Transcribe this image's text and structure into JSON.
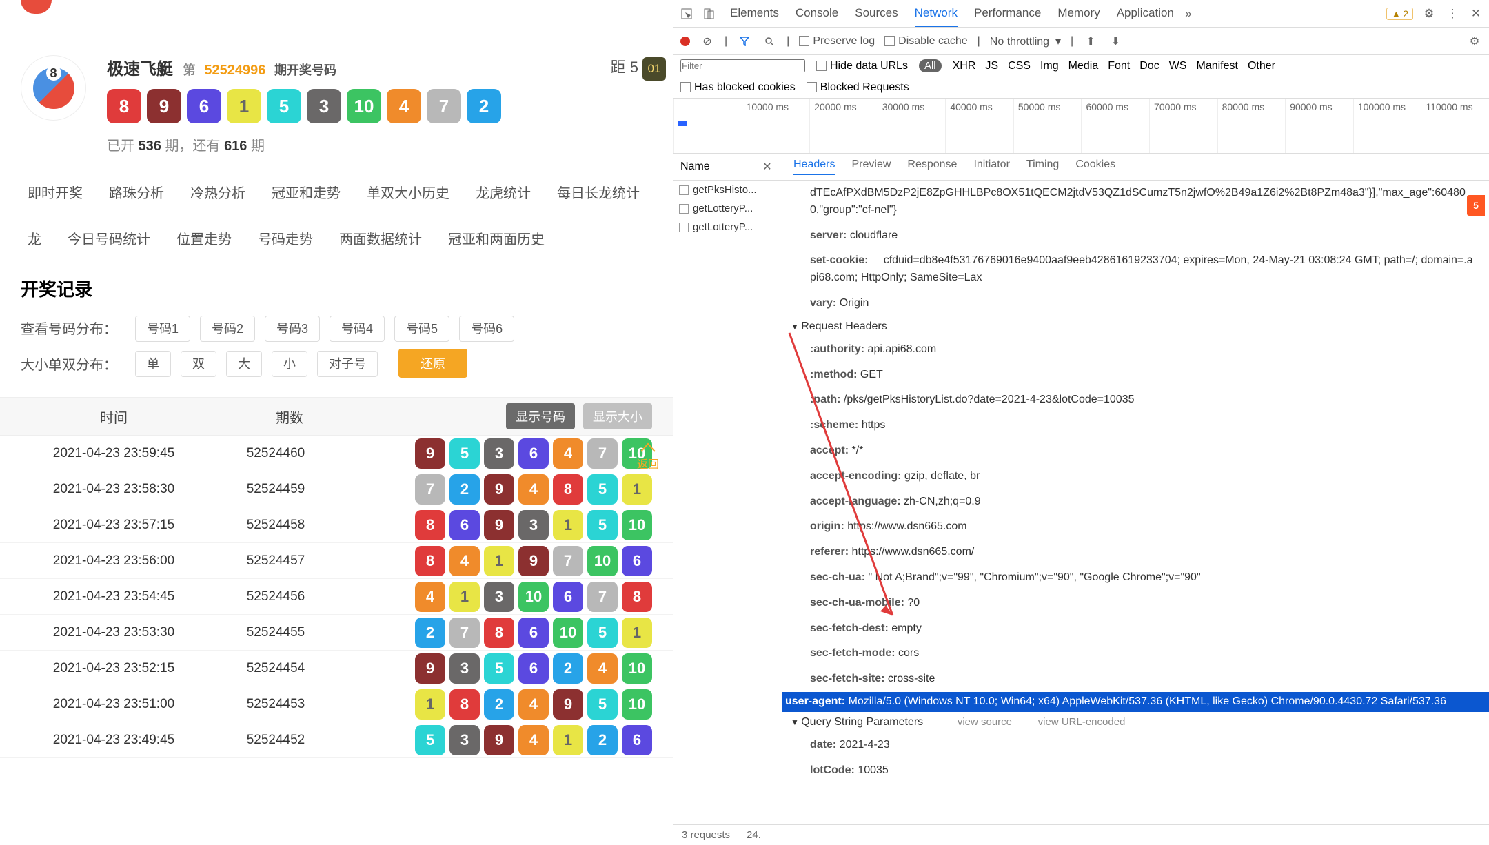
{
  "page": {
    "title": "极速飞艇",
    "di": "第",
    "issue": "52524996",
    "issue_label": "期开奖号码",
    "balls": [
      8,
      9,
      6,
      1,
      5,
      3,
      10,
      4,
      7,
      2
    ],
    "stat_prefix": "已开",
    "stat_open": "536",
    "stat_mid": "期，还有",
    "stat_left": "616",
    "stat_suffix": "期",
    "side_prefix": "距 5",
    "side_num": "01"
  },
  "tabs": [
    "即时开奖",
    "路珠分析",
    "冷热分析",
    "冠亚和走势",
    "单双大小历史",
    "龙虎统计",
    "每日长龙统计",
    "龙",
    "今日号码统计",
    "位置走势",
    "号码走势",
    "两面数据统计",
    "冠亚和两面历史"
  ],
  "section": "开奖记录",
  "filter1": {
    "label": "查看号码分布：",
    "opts": [
      "号码1",
      "号码2",
      "号码3",
      "号码4",
      "号码5",
      "号码6"
    ]
  },
  "filter2": {
    "label": "大小单双分布：",
    "opts": [
      "单",
      "双",
      "大",
      "小",
      "对子号"
    ],
    "reset": "还原"
  },
  "back": "返回",
  "thead": {
    "time": "时间",
    "issue": "期数",
    "btn1": "显示号码",
    "btn2": "显示大小"
  },
  "rows": [
    {
      "t": "2021-04-23 23:59:45",
      "i": "52524460",
      "n": [
        9,
        5,
        3,
        6,
        4,
        7,
        10
      ]
    },
    {
      "t": "2021-04-23 23:58:30",
      "i": "52524459",
      "n": [
        7,
        2,
        9,
        4,
        8,
        5,
        1
      ]
    },
    {
      "t": "2021-04-23 23:57:15",
      "i": "52524458",
      "n": [
        8,
        6,
        9,
        3,
        1,
        5,
        10
      ]
    },
    {
      "t": "2021-04-23 23:56:00",
      "i": "52524457",
      "n": [
        8,
        4,
        1,
        9,
        7,
        10,
        6
      ]
    },
    {
      "t": "2021-04-23 23:54:45",
      "i": "52524456",
      "n": [
        4,
        1,
        3,
        10,
        6,
        7,
        8
      ]
    },
    {
      "t": "2021-04-23 23:53:30",
      "i": "52524455",
      "n": [
        2,
        7,
        8,
        6,
        10,
        5,
        1
      ]
    },
    {
      "t": "2021-04-23 23:52:15",
      "i": "52524454",
      "n": [
        9,
        3,
        5,
        6,
        2,
        4,
        10
      ]
    },
    {
      "t": "2021-04-23 23:51:00",
      "i": "52524453",
      "n": [
        1,
        8,
        2,
        4,
        9,
        5,
        10
      ]
    },
    {
      "t": "2021-04-23 23:49:45",
      "i": "52524452",
      "n": [
        5,
        3,
        9,
        4,
        1,
        2,
        6
      ]
    }
  ],
  "dt": {
    "tabs": [
      "Elements",
      "Console",
      "Sources",
      "Network",
      "Performance",
      "Memory",
      "Application"
    ],
    "warn": "2",
    "preserve": "Preserve log",
    "disable": "Disable cache",
    "throttle": "No throttling",
    "filter_ph": "Filter",
    "hide": "Hide data URLs",
    "all": "All",
    "types": [
      "XHR",
      "JS",
      "CSS",
      "Img",
      "Media",
      "Font",
      "Doc",
      "WS",
      "Manifest",
      "Other"
    ],
    "blocked1": "Has blocked cookies",
    "blocked2": "Blocked Requests",
    "ticks": [
      "10000 ms",
      "20000 ms",
      "30000 ms",
      "40000 ms",
      "50000 ms",
      "60000 ms",
      "70000 ms",
      "80000 ms",
      "90000 ms",
      "100000 ms",
      "110000 ms"
    ],
    "name_col": "Name",
    "names": [
      "getPksHisto...",
      "getLotteryP...",
      "getLotteryP..."
    ],
    "det_tabs": [
      "Headers",
      "Preview",
      "Response",
      "Initiator",
      "Timing",
      "Cookies"
    ],
    "resp_snip": "dTEcAfPXdBM5DzP2jE8ZpGHHLBPc8OX51tQECM2jtdV53QZ1dSCumzT5n2jwfO%2B49a1Z6i2%2Bt8PZm48a3\"}],\"max_age\":604800,\"group\":\"cf-nel\"}",
    "server_l": "server:",
    "server_v": "cloudflare",
    "cookie_l": "set-cookie:",
    "cookie_v": "__cfduid=db8e4f53176769016e9400aaf9eeb42861619233704; expires=Mon, 24-May-21 03:08:24 GMT; path=/; domain=.api68.com; HttpOnly; SameSite=Lax",
    "vary_l": "vary:",
    "vary_v": "Origin",
    "req_sect": "Request Headers",
    "req": [
      {
        "k": ":authority:",
        "v": "api.api68.com"
      },
      {
        "k": ":method:",
        "v": "GET"
      },
      {
        "k": ":path:",
        "v": "/pks/getPksHistoryList.do?date=2021-4-23&lotCode=10035"
      },
      {
        "k": ":scheme:",
        "v": "https"
      },
      {
        "k": "accept:",
        "v": "*/*"
      },
      {
        "k": "accept-encoding:",
        "v": "gzip, deflate, br"
      },
      {
        "k": "accept-language:",
        "v": "zh-CN,zh;q=0.9"
      },
      {
        "k": "origin:",
        "v": "https://www.dsn665.com"
      },
      {
        "k": "referer:",
        "v": "https://www.dsn665.com/"
      },
      {
        "k": "sec-ch-ua:",
        "v": "\" Not A;Brand\";v=\"99\", \"Chromium\";v=\"90\", \"Google Chrome\";v=\"90\""
      },
      {
        "k": "sec-ch-ua-mobile:",
        "v": "?0"
      },
      {
        "k": "sec-fetch-dest:",
        "v": "empty"
      },
      {
        "k": "sec-fetch-mode:",
        "v": "cors"
      },
      {
        "k": "sec-fetch-site:",
        "v": "cross-site"
      }
    ],
    "ua_k": "user-agent:",
    "ua_v": "Mozilla/5.0 (Windows NT 10.0; Win64; x64) AppleWebKit/537.36 (KHTML, like Gecko) Chrome/90.0.4430.72 Safari/537.36",
    "qs_sect": "Query String Parameters",
    "vs": "view source",
    "vu": "view URL-encoded",
    "qs": [
      {
        "k": "date:",
        "v": "2021-4-23"
      },
      {
        "k": "lotCode:",
        "v": "10035"
      }
    ],
    "status": {
      "req": "3 requests",
      "size": "24."
    }
  }
}
